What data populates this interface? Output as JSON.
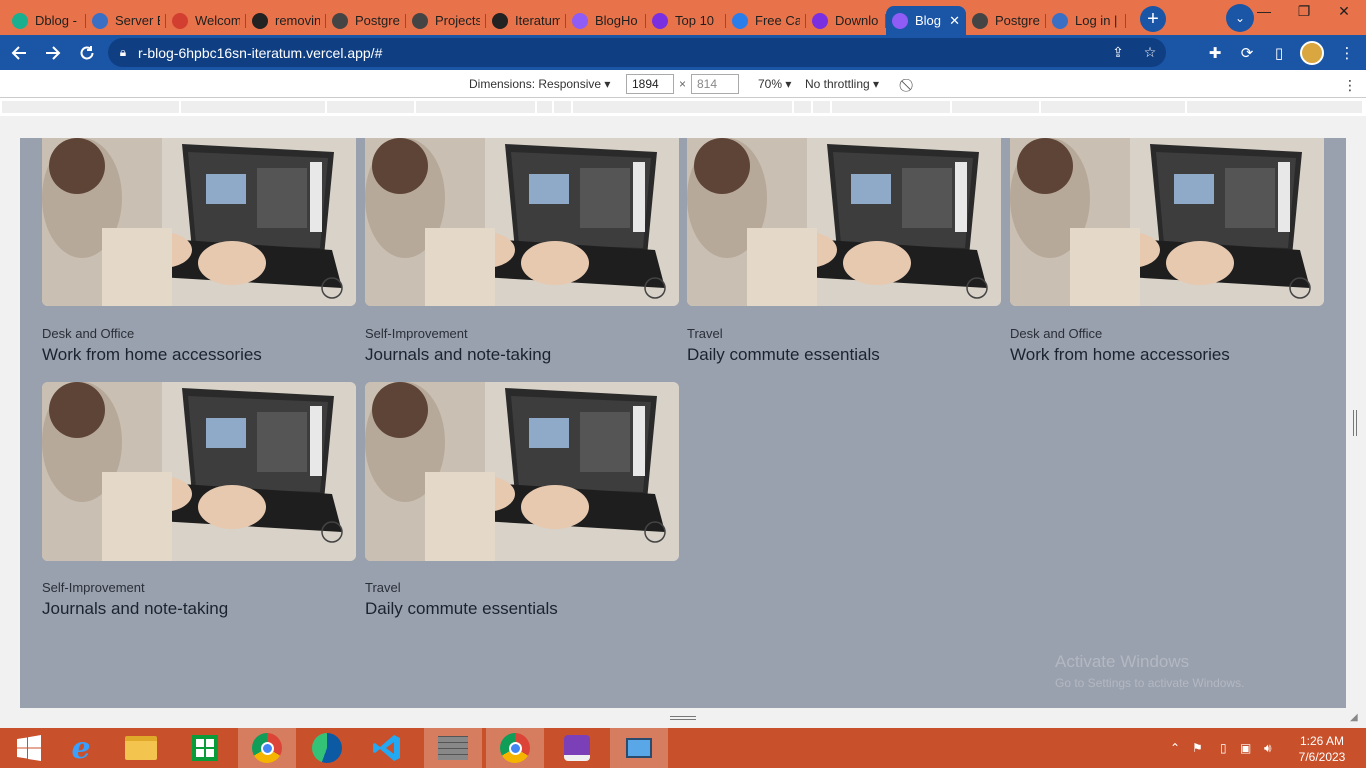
{
  "browser": {
    "tabs": [
      {
        "label": "Dblog -",
        "icon": "dblog-icon",
        "color": "#1ab08f"
      },
      {
        "label": "Server E",
        "icon": "globe-icon",
        "color": "#3a6fc4"
      },
      {
        "label": "Welcom",
        "icon": "gmail-icon",
        "color": "#d23f31"
      },
      {
        "label": "removin",
        "icon": "github-icon",
        "color": "#222222"
      },
      {
        "label": "Postgre",
        "icon": "elephant-icon",
        "color": "#444444"
      },
      {
        "label": "Projects",
        "icon": "elephant-icon",
        "color": "#444444"
      },
      {
        "label": "Iteratum",
        "icon": "github-icon",
        "color": "#222222"
      },
      {
        "label": "BlogHo",
        "icon": "vite-icon",
        "color": "#8f5cf5"
      },
      {
        "label": "Top 10",
        "icon": "canva-icon",
        "color": "#7a2fe0"
      },
      {
        "label": "Free Ca",
        "icon": "image-icon",
        "color": "#2b7de9"
      },
      {
        "label": "Downlo",
        "icon": "canva-icon",
        "color": "#7a2fe0"
      },
      {
        "label": "Blog",
        "icon": "vite-icon",
        "color": "#8f5cf5",
        "active": true
      },
      {
        "label": "Postgre",
        "icon": "elephant-icon",
        "color": "#444444"
      },
      {
        "label": "Log in |",
        "icon": "globe-icon",
        "color": "#3a6fc4"
      }
    ],
    "url": "r-blog-6hpbc16sn-iteratum.vercel.app/#"
  },
  "devtools": {
    "dimensions_label": "Dimensions: Responsive",
    "width": "1894",
    "height": "814",
    "times": "×",
    "zoom": "70%",
    "throttling": "No throttling"
  },
  "posts": [
    {
      "category": "Desk and Office",
      "title": "Work from home accessories"
    },
    {
      "category": "Self-Improvement",
      "title": "Journals and note-taking"
    },
    {
      "category": "Travel",
      "title": "Daily commute essentials"
    },
    {
      "category": "Desk and Office",
      "title": "Work from home accessories"
    },
    {
      "category": "Self-Improvement",
      "title": "Journals and note-taking"
    },
    {
      "category": "Travel",
      "title": "Daily commute essentials"
    }
  ],
  "watermark": {
    "line1": "Activate Windows",
    "line2": "Go to Settings to activate Windows."
  },
  "taskbar": {
    "time": "1:26 AM",
    "date": "7/6/2023"
  }
}
